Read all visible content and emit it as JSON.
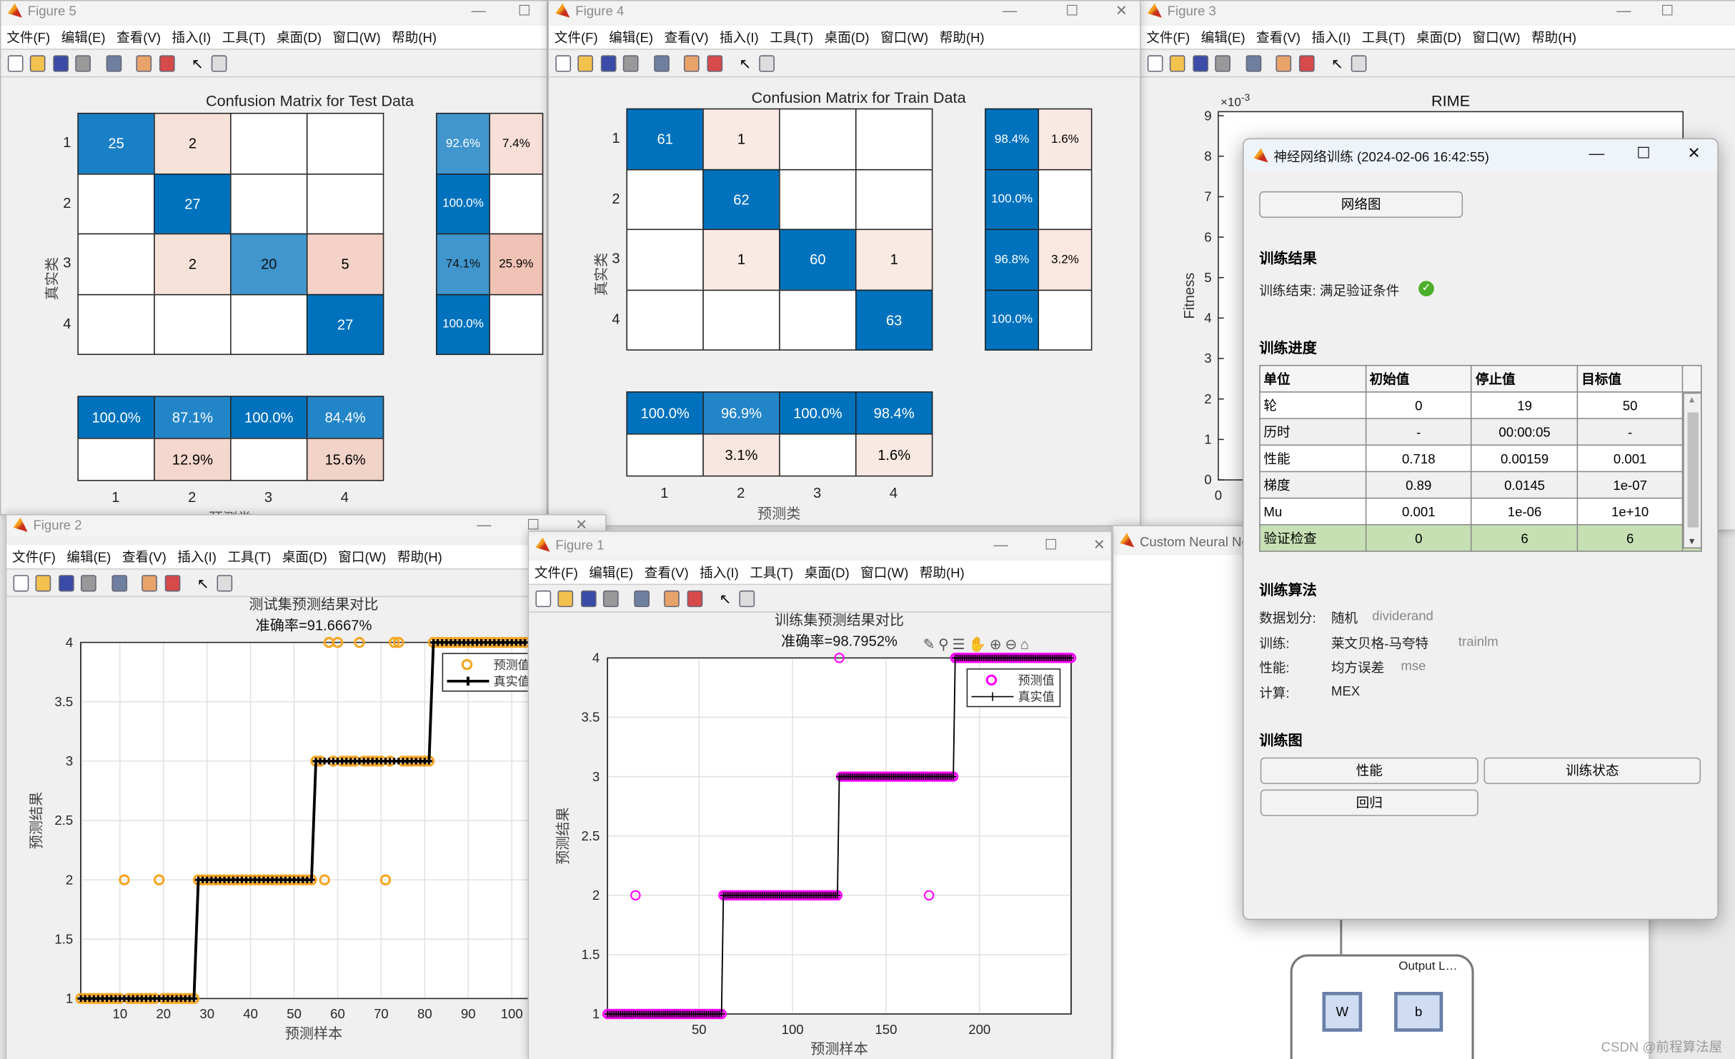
{
  "menu": [
    "文件(F)",
    "编辑(E)",
    "查看(V)",
    "插入(I)",
    "工具(T)",
    "桌面(D)",
    "窗口(W)",
    "帮助(H)"
  ],
  "toolbar_icons": [
    "new-figure-icon",
    "open-icon",
    "save-icon",
    "print-icon",
    "link-icon",
    "colorbar-icon",
    "legend-icon",
    "pointer-icon",
    "property-editor-icon"
  ],
  "colors": {
    "diag": "#0072BD",
    "miss": "#F0B8A0",
    "pred": "#F5A623",
    "pred_train": "#FF00FF",
    "true": "#000000",
    "valid": "#C6E0B4"
  },
  "figure5": {
    "title": "Figure 5",
    "chart_data": {
      "type": "heatmap",
      "title": "Confusion Matrix for Test Data",
      "xlabel": "预测类",
      "ylabel": "真实类",
      "classes": [
        "1",
        "2",
        "3",
        "4"
      ],
      "matrix": [
        [
          25,
          2,
          0,
          0
        ],
        [
          0,
          27,
          0,
          0
        ],
        [
          0,
          2,
          20,
          5
        ],
        [
          0,
          0,
          0,
          27
        ]
      ],
      "row_summary": [
        [
          "92.6%",
          "7.4%"
        ],
        [
          "100.0%",
          ""
        ],
        [
          "74.1%",
          "25.9%"
        ],
        [
          "100.0%",
          ""
        ]
      ],
      "col_summary": [
        [
          "100.0%",
          "87.1%",
          "100.0%",
          "84.4%"
        ],
        [
          "",
          "12.9%",
          "",
          "15.6%"
        ]
      ]
    }
  },
  "figure4": {
    "title": "Figure 4",
    "chart_data": {
      "type": "heatmap",
      "title": "Confusion Matrix for Train Data",
      "xlabel": "预测类",
      "ylabel": "真实类",
      "classes": [
        "1",
        "2",
        "3",
        "4"
      ],
      "matrix": [
        [
          61,
          1,
          0,
          0
        ],
        [
          0,
          62,
          0,
          0
        ],
        [
          0,
          1,
          60,
          1
        ],
        [
          0,
          0,
          0,
          63
        ]
      ],
      "row_summary": [
        [
          "98.4%",
          "1.6%"
        ],
        [
          "100.0%",
          ""
        ],
        [
          "96.8%",
          "3.2%"
        ],
        [
          "100.0%",
          ""
        ]
      ],
      "col_summary": [
        [
          "100.0%",
          "96.9%",
          "100.0%",
          "98.4%"
        ],
        [
          "",
          "3.1%",
          "",
          "1.6%"
        ]
      ]
    }
  },
  "figure2": {
    "title": "Figure 2",
    "chart_data": {
      "type": "line",
      "title": "测试集预测结果对比",
      "subtitle": "准确率=91.6667%",
      "xlabel": "预测样本",
      "ylabel": "预测结果",
      "xlim": [
        1,
        108
      ],
      "ylim": [
        1,
        4
      ],
      "xticks": [
        10,
        20,
        30,
        40,
        50,
        60,
        70,
        80,
        90,
        100
      ],
      "yticks": [
        1,
        1.5,
        2,
        2.5,
        3,
        3.5,
        4
      ],
      "grid": true,
      "legend_position": "top-right",
      "legend": [
        "预测值",
        "真实值"
      ],
      "true_runs": [
        {
          "value": 1,
          "count": 27
        },
        {
          "value": 2,
          "count": 27
        },
        {
          "value": 3,
          "count": 27
        },
        {
          "value": 4,
          "count": 27
        }
      ],
      "mispredictions": [
        {
          "x": 11,
          "y": 2
        },
        {
          "x": 19,
          "y": 2
        },
        {
          "x": 57,
          "y": 2
        },
        {
          "x": 71,
          "y": 2
        },
        {
          "x": 58,
          "y": 4
        },
        {
          "x": 60,
          "y": 4
        },
        {
          "x": 65,
          "y": 4
        },
        {
          "x": 73,
          "y": 4
        },
        {
          "x": 74,
          "y": 4
        }
      ]
    }
  },
  "figure1": {
    "title": "Figure 1",
    "chart_data": {
      "type": "line",
      "title": "训练集预测结果对比",
      "subtitle": "准确率=98.7952%",
      "xlabel": "预测样本",
      "ylabel": "预测结果",
      "xlim": [
        1,
        249
      ],
      "ylim": [
        1,
        4
      ],
      "xticks": [
        50,
        100,
        150,
        200
      ],
      "yticks": [
        1,
        1.5,
        2,
        2.5,
        3,
        3.5,
        4
      ],
      "grid": true,
      "legend_position": "top-right",
      "legend": [
        "预测值",
        "真实值"
      ],
      "true_runs": [
        {
          "value": 1,
          "count": 62
        },
        {
          "value": 2,
          "count": 62
        },
        {
          "value": 3,
          "count": 62
        },
        {
          "value": 4,
          "count": 63
        }
      ],
      "mispredictions": [
        {
          "x": 16,
          "y": 2
        },
        {
          "x": 125,
          "y": 4
        },
        {
          "x": 173,
          "y": 2
        }
      ]
    }
  },
  "figure3": {
    "title": "Figure 3",
    "chart_data": {
      "type": "line",
      "title": "RIME",
      "ylabel": "Fitness",
      "exponent": "×10",
      "exponent_power": "-3",
      "yticks": [
        "0",
        "1",
        "2",
        "3",
        "4",
        "5",
        "6",
        "7",
        "8",
        "9"
      ],
      "xticks": [
        "0"
      ],
      "ylim": [
        0,
        9
      ]
    }
  },
  "custom_nn": {
    "title": "Custom Neural Ne",
    "layer_label": "Output L…",
    "w": "W",
    "b": "b"
  },
  "dialog": {
    "title": "神经网络训练 (2024-02-06 16:42:55)",
    "network_button": "网络图",
    "results_heading": "训练结果",
    "results_text": "训练结束: 满足验证条件",
    "progress_heading": "训练进度",
    "table_headers": [
      "单位",
      "初始值",
      "停止值",
      "目标值"
    ],
    "table_rows": [
      [
        "轮",
        "0",
        "19",
        "50"
      ],
      [
        "历时",
        "-",
        "00:00:05",
        "-"
      ],
      [
        "性能",
        "0.718",
        "0.00159",
        "0.001"
      ],
      [
        "梯度",
        "0.89",
        "0.0145",
        "1e-07"
      ],
      [
        "Mu",
        "0.001",
        "1e-06",
        "1e+10"
      ],
      [
        "验证检查",
        "0",
        "6",
        "6"
      ]
    ],
    "algo_heading": "训练算法",
    "algo": [
      {
        "label": "数据划分:",
        "value": "随机",
        "code": "dividerand"
      },
      {
        "label": "训练:",
        "value": "莱文贝格-马夸特",
        "code": "trainlm"
      },
      {
        "label": "性能:",
        "value": "均方误差",
        "code": "mse"
      },
      {
        "label": "计算:",
        "value": "MEX",
        "code": ""
      }
    ],
    "plots_heading": "训练图",
    "plot_buttons": [
      "性能",
      "训练状态",
      "回归"
    ]
  },
  "watermark": "CSDN @前程算法屋"
}
